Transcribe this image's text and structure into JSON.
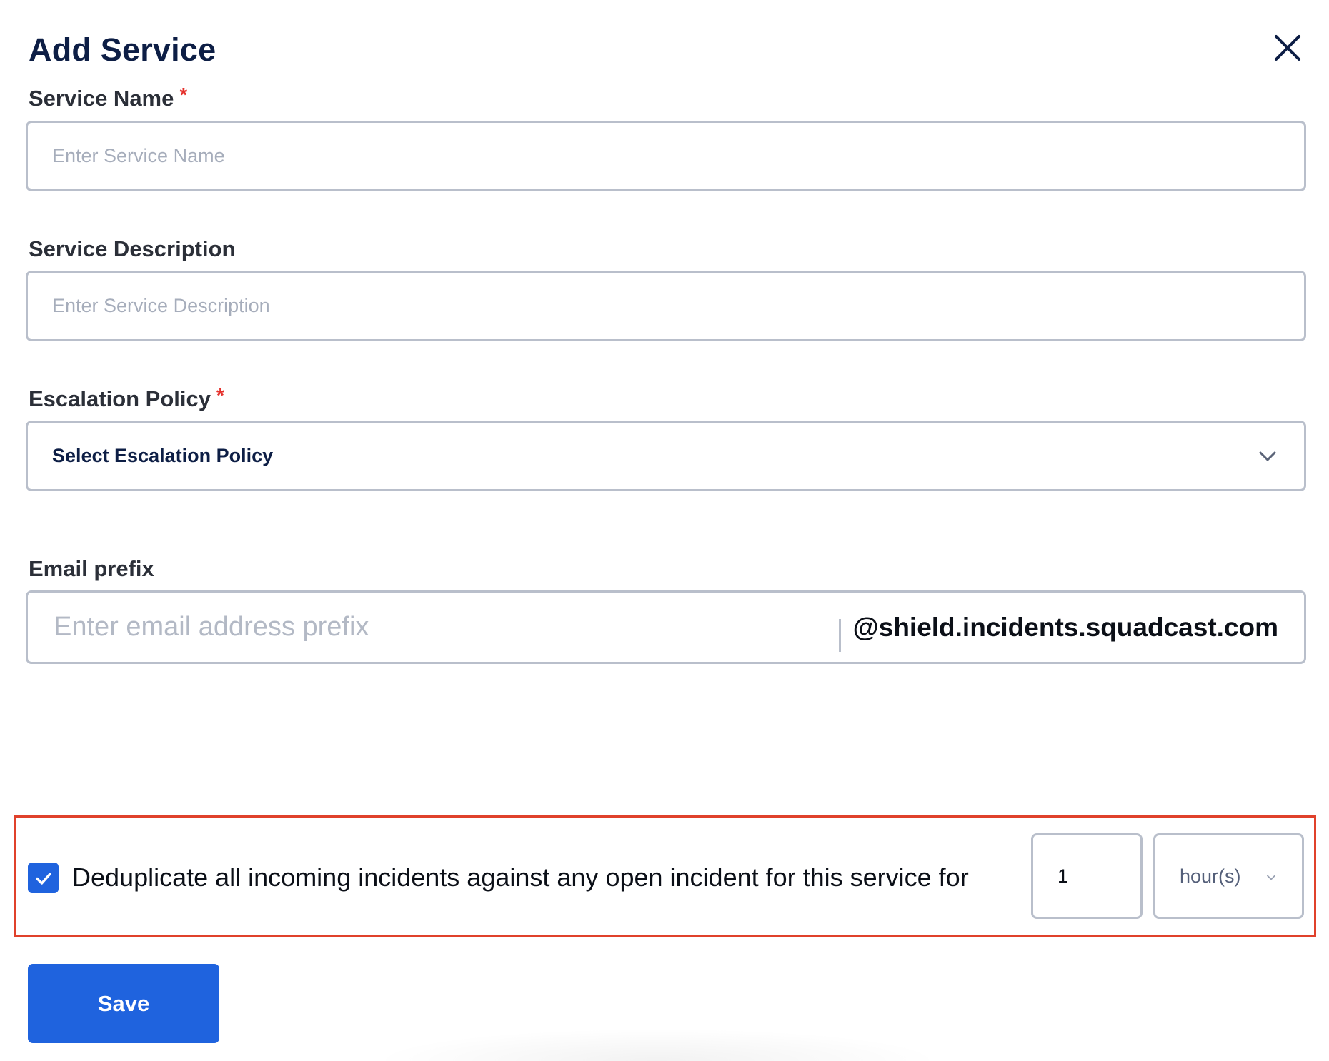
{
  "dialog": {
    "title": "Add Service",
    "close_icon": "close-icon"
  },
  "service_name": {
    "label": "Service Name",
    "required_mark": "*",
    "placeholder": "Enter Service Name",
    "value": ""
  },
  "service_description": {
    "label": "Service Description",
    "placeholder": "Enter Service Description",
    "value": ""
  },
  "escalation_policy": {
    "label": "Escalation Policy",
    "required_mark": "*",
    "selected": "Select Escalation Policy",
    "icon": "chevron-down-icon"
  },
  "email_prefix": {
    "label": "Email prefix",
    "placeholder": "Enter email address prefix",
    "value": "",
    "domain": "@shield.incidents.squadcast.com"
  },
  "deduplication": {
    "checked": true,
    "text": "Deduplicate all incoming incidents against any open incident for this service for",
    "quantity": "1",
    "unit": "hour(s)",
    "icon": "check-icon"
  },
  "actions": {
    "save_label": "Save"
  },
  "colors": {
    "title": "#0d1e45",
    "primary": "#1f63de",
    "required": "#e5322d",
    "highlight_border": "#e0412b",
    "field_border": "#b9bfcb"
  }
}
